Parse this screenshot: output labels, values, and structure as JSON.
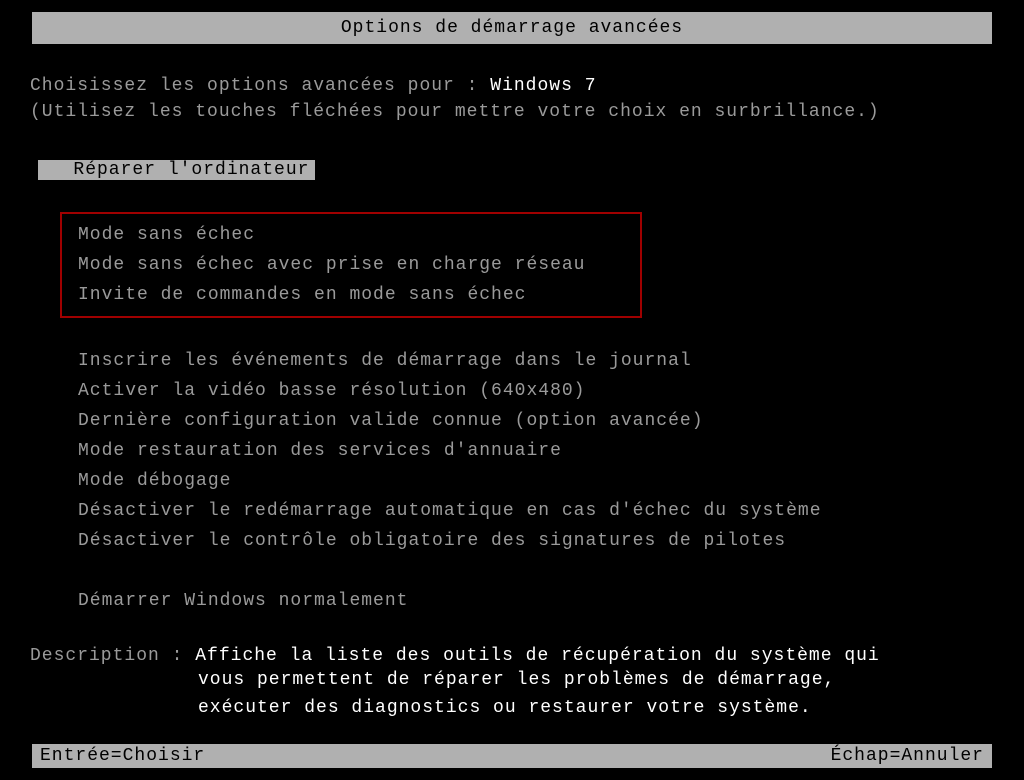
{
  "title": "Options de démarrage avancées",
  "instructions": {
    "prefix": "Choisissez les options avancées pour : ",
    "os": "Windows 7",
    "hint": "(Utilisez les touches fléchées pour mettre votre choix en surbrillance.)"
  },
  "repair": "Réparer l'ordinateur",
  "safeModeOptions": [
    "Mode sans échec",
    "Mode sans échec avec prise en charge réseau",
    "Invite de commandes en mode sans échec"
  ],
  "options": [
    "Inscrire les événements de démarrage dans le journal",
    "Activer la vidéo basse résolution (640x480)",
    "Dernière configuration valide connue (option avancée)",
    "Mode restauration des services d'annuaire",
    "Mode débogage",
    "Désactiver le redémarrage automatique en cas d'échec du système",
    "Désactiver le contrôle obligatoire des signatures de pilotes"
  ],
  "startNormal": "Démarrer Windows normalement",
  "description": {
    "label": "Description : ",
    "line1": "Affiche la liste des outils de récupération du système qui",
    "line2": "vous permettent de réparer les problèmes de démarrage,",
    "line3": "exécuter des diagnostics ou restaurer votre système."
  },
  "footer": {
    "enter": "Entrée=Choisir",
    "escape": "Échap=Annuler"
  }
}
